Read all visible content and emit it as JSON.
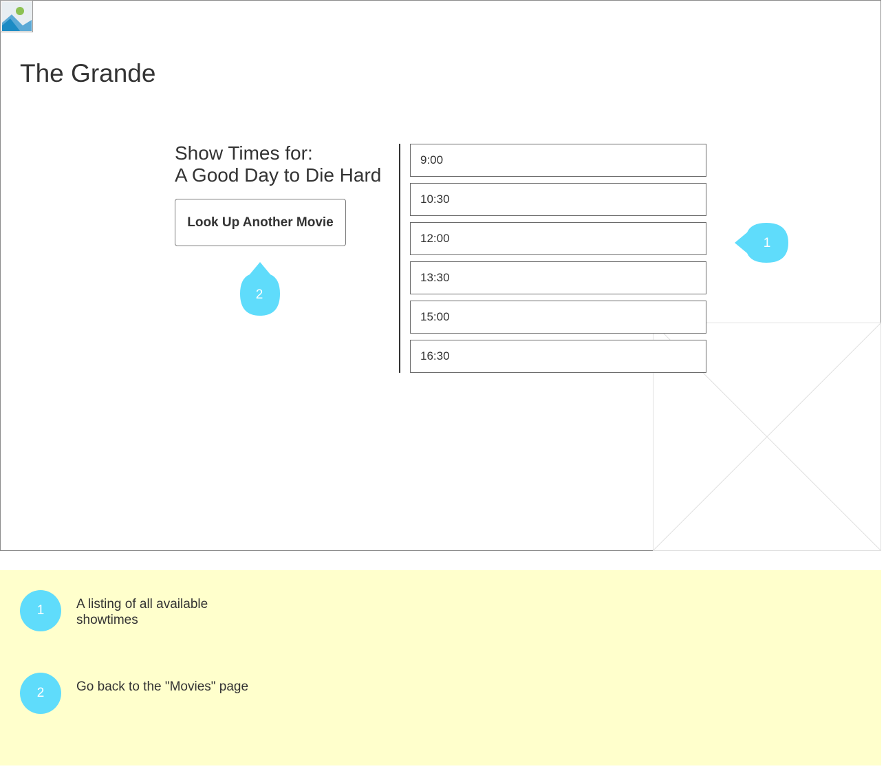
{
  "app": {
    "title": "The Grande",
    "logo_icon": "image-icon"
  },
  "showtimes": {
    "heading_line1": "Show Times for:",
    "heading_line2": "A Good Day to Die Hard",
    "lookup_button_label": "Look Up Another Movie",
    "times": [
      "9:00",
      "10:30",
      "12:00",
      "13:30",
      "15:00",
      "16:30"
    ]
  },
  "annotations": {
    "marker_color": "#5fdcfb",
    "markers": [
      {
        "number": "1"
      },
      {
        "number": "2"
      }
    ],
    "notes": [
      {
        "number": "1",
        "text": "A listing of all available showtimes"
      },
      {
        "number": "2",
        "text": "Go back to the \"Movies\" page"
      }
    ],
    "notes_background": "#ffffcc"
  }
}
